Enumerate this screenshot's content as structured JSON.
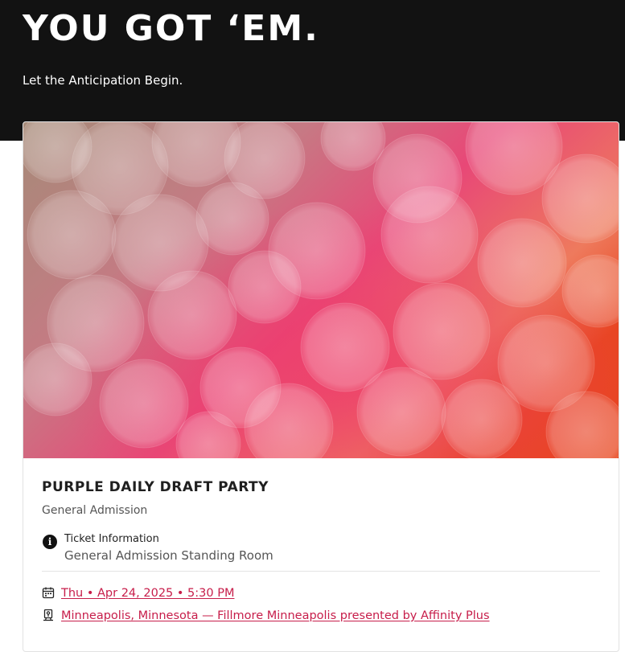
{
  "header": {
    "title": "YOU GOT ‘EM.",
    "subtitle": "Let the Anticipation Begin."
  },
  "event": {
    "title": "PURPLE DAILY DRAFT PARTY",
    "ticket_type": "General Admission",
    "ticket_info": {
      "icon": "info-icon",
      "label": "Ticket Information",
      "value": "General Admission Standing Room"
    },
    "date_link": "Thu • Apr 24, 2025 • 5:30 PM",
    "venue_link": "Minneapolis, Minnesota — Fillmore Minneapolis presented by Affinity Plus"
  },
  "colors": {
    "header_bg": "#121212",
    "link": "#c71d4a",
    "text_primary": "#1f1f1f",
    "text_secondary": "#555555"
  }
}
